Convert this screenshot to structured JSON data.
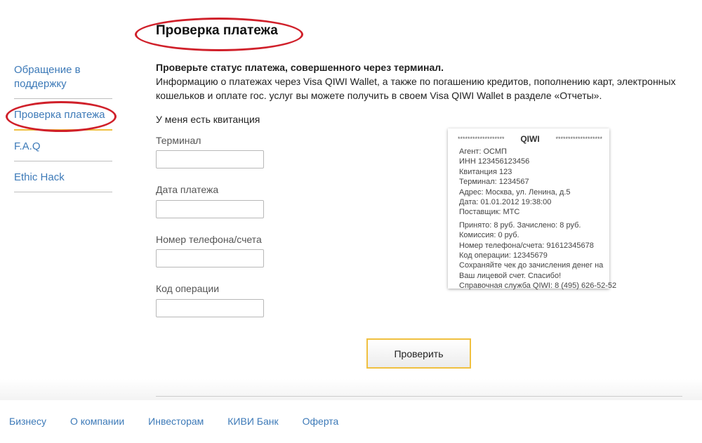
{
  "sidebar": {
    "items": [
      {
        "label": "Обращение в поддержку"
      },
      {
        "label": "Проверка платежа"
      },
      {
        "label": "F.A.Q"
      },
      {
        "label": "Ethic Hack"
      }
    ]
  },
  "main": {
    "title": "Проверка платежа",
    "intro_bold": "Проверьте статус платежа, совершенного через терминал.",
    "intro_desc": "Информацию о платежах через Visa QIWI Wallet, а также по погашению кредитов, пополнению карт, электронных кошельков и оплате гос. услуг вы можете получить в своем Visa QIWI Wallet в разделе «Отчеты».",
    "form_heading": "У меня есть квитанция",
    "fields": [
      {
        "label": "Терминал",
        "value": ""
      },
      {
        "label": "Дата платежа",
        "value": ""
      },
      {
        "label": "Номер телефона/счета",
        "value": ""
      },
      {
        "label": "Код операции",
        "value": ""
      }
    ],
    "submit_label": "Проверить"
  },
  "receipt": {
    "stars_left": "*******************",
    "brand": "QIWI",
    "stars_right": "*******************",
    "lines": [
      "Агент: ОСМП",
      "ИНН 123456123456",
      "Квитанция 123",
      "Терминал: 1234567",
      "Адрес: Москва, ул. Ленина, д.5",
      "Дата: 01.01.2012 19:38:00",
      "Поставщик: МТС",
      "Принято: 8 руб.  Зачислено: 8 руб.",
      "Комиссия: 0 руб.",
      "Номер телефона/счета: 91612345678",
      "Код операции: 12345679",
      "Сохраняйте чек до зачисления денег на",
      "Ваш лицевой счет. Спасибо!",
      "Справочная служба QIWI: 8 (495) 626-52-52"
    ]
  },
  "footer": {
    "links": [
      "Бизнесу",
      "О компании",
      "Инвесторам",
      "КИВИ Банк",
      "Оферта"
    ]
  },
  "colors": {
    "link": "#3d7ab8",
    "marker": "#d0202a",
    "accent": "#f0c040"
  }
}
